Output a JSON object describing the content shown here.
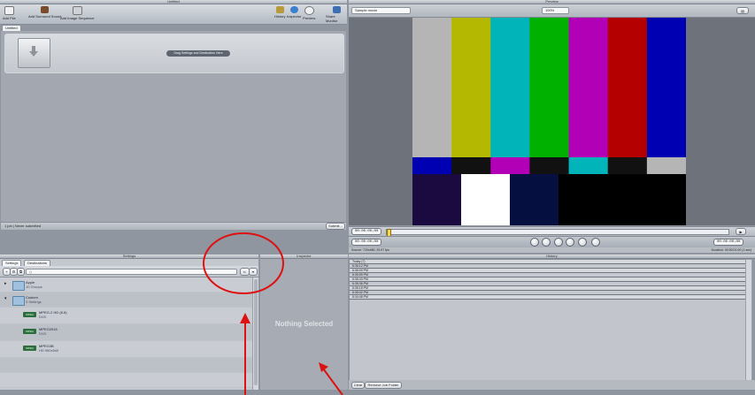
{
  "batch": {
    "title": "Untitled",
    "toolbar": {
      "add_file": "Add File",
      "add_surround": "Add Surround Sound",
      "add_image_sequence": "Add Image Sequence",
      "history": "History",
      "inspector": "Inspector",
      "preview": "Preview",
      "share_monitor": "Share Monitor"
    },
    "tab": "Untitled",
    "drop_label": "Drag Settings and Destination Here",
    "status": "1 job  |  Never submitted",
    "submit": "Submit..."
  },
  "settings": {
    "title": "Settings",
    "tabs": [
      "Settings",
      "Destinations"
    ],
    "search_placeholder": "Q",
    "groups": [
      {
        "name": "Apple",
        "sub": "10 Groups"
      },
      {
        "name": "Custom",
        "sub": "3 Settings"
      }
    ],
    "items": [
      {
        "badge": "MPEG",
        "name": "MPEG-2 HD (6.6)",
        "sub": "DVD"
      },
      {
        "badge": "MPEG",
        "name": "MPEG2916",
        "sub": "DVD"
      },
      {
        "badge": "MPEG",
        "name": "MPEG4B",
        "sub": "HD 960x540"
      }
    ]
  },
  "inspector": {
    "title": "Inspector",
    "nothing_selected": "Nothing Selected"
  },
  "preview": {
    "title": "Preview",
    "source_select": "Sample movie",
    "zoom": "100%",
    "timecode_in": "00:00:00;00",
    "timecode_out": "00:00:00;00",
    "timecode_current": "00:00:00;00",
    "timecode_end": "00:00:00;00",
    "source_info": "Source: 720x480, 29.97 fps",
    "duration": "Duration: 00:00:01:00 (1 sec)"
  },
  "history": {
    "title": "History",
    "rows": [
      "Today (7)",
      "6:36:12 PM",
      "6:36:09 PM",
      "6:35:59 PM",
      "6:35:43 PM",
      "6:35:36 PM",
      "6:35:18 PM",
      "6:35:02 PM",
      "6:34:48 PM"
    ],
    "clear": "Clear",
    "reveal": "Remove Job Folder"
  },
  "colors": {
    "bars_top": [
      "#b5b5b5",
      "#b4b800",
      "#00b4b9",
      "#00b100",
      "#b100b6",
      "#b40000",
      "#0000b3"
    ],
    "bars_mid": [
      "#0000b3",
      "#111111",
      "#b100b6",
      "#111111",
      "#00b4b9",
      "#111111",
      "#b5b5b5"
    ],
    "bars_bottom": [
      "#1b0a3f",
      "#ffffff",
      "#061040",
      "#000000",
      "#000000",
      "#000000"
    ],
    "annotation": "#dd1111"
  }
}
